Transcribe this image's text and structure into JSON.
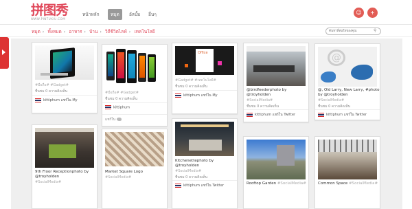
{
  "logo": {
    "mark": "拼图秀",
    "sub": "WWW.PINTUXIU.COM"
  },
  "nav": {
    "items": [
      "หน้าหลัก",
      "หมุด",
      "อัลบั้ม",
      "อื่นๆ"
    ]
  },
  "breadcrumb": {
    "items": [
      "หมุด",
      "ทั้งหมด",
      "อาหาร",
      "บ้าน",
      "วิถีชีวิตไลฟ์",
      "เทคโนโลยี"
    ]
  },
  "search": {
    "placeholder": "ค้นหาที่สนใจของคุณ"
  },
  "common": {
    "stats": "ชื่นชม 0 ความคิดเห็น",
    "user": "kittiphum",
    "msg_by": "แชร์ใน",
    "twitter": "Twitter",
    "my": "My"
  },
  "cards": [
    {
      "caption": "",
      "tags": "#มือถือ# #Gadget#",
      "footer": "kittiphum แชร์ใน My"
    },
    {
      "caption": "",
      "tags": "#มือถือ# #Gadget#",
      "footer": "แชร์ใน"
    },
    {
      "caption": "",
      "tags": "#Gadget# #เทคโนโลยี#",
      "footer": "kittiphum แชร์ใน My"
    },
    {
      "caption": "@birdfeederphoto by",
      "caption2": "@troyholden",
      "tags": "#SocialMedia#",
      "footer": "kittiphum แชร์ใน Twitter"
    },
    {
      "caption": "@, Old Larry, New Larry, #photo",
      "caption2": "by @troyholden",
      "tags": "#SocialMedia#",
      "footer": "kittiphum แชร์ใน Twitter"
    },
    {
      "caption": "9th Floor Receptionphoto by",
      "caption2": "@troyholden",
      "tags": "#SocialMedia#",
      "footer": ""
    },
    {
      "caption": "Market Square Logo",
      "tags": "#SocialMedia#",
      "footer": ""
    },
    {
      "caption": "Kitchenettephoto by",
      "caption2": "@troyholden",
      "tags": "#SocialMedia#",
      "footer": "kittiphum แชร์ใน Twitter"
    },
    {
      "caption": "Rooftop Garden",
      "tags": "#SocialMedia#",
      "footer": ""
    },
    {
      "caption": "Common Space",
      "tags": "#SocialMedia#",
      "footer": ""
    }
  ],
  "colors": {
    "accent": "#e0495b",
    "board": "#efefef"
  }
}
